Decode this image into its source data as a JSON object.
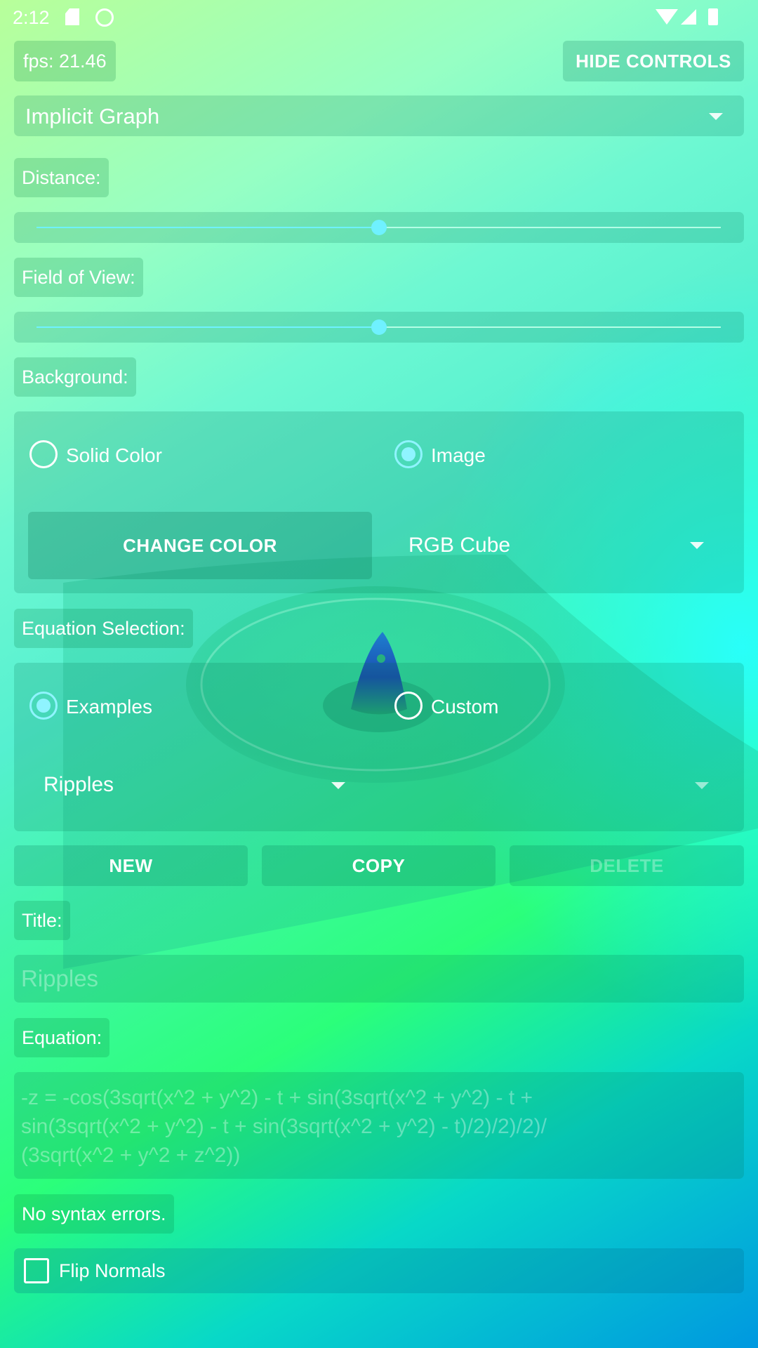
{
  "status_bar": {
    "time": "2:12",
    "icons": [
      "sd-card-icon",
      "android-icon",
      "wifi-icon",
      "signal-icon",
      "battery-icon"
    ]
  },
  "fps_label": "fps: 21.46",
  "hide_controls_label": "HIDE CONTROLS",
  "graph_type": {
    "selected": "Implicit Graph"
  },
  "distance": {
    "label": "Distance:",
    "value": 0.5
  },
  "field_of_view": {
    "label": "Field of View:",
    "value": 0.5
  },
  "background": {
    "label": "Background:",
    "options": [
      "Solid Color",
      "Image"
    ],
    "selected": "Image",
    "change_color_label": "CHANGE COLOR",
    "image_selected": "RGB Cube"
  },
  "equation_selection": {
    "label": "Equation Selection:",
    "options": [
      "Examples",
      "Custom"
    ],
    "selected": "Examples",
    "example_selected": "Ripples"
  },
  "actions": {
    "new": "NEW",
    "copy": "COPY",
    "delete": "DELETE"
  },
  "title_field": {
    "label": "Title:",
    "value": "Ripples"
  },
  "equation_field": {
    "label": "Equation:",
    "lines": [
      "-z = -cos(3sqrt(x^2 + y^2) - t + sin(3sqrt(x^2 + y^2) - t +",
      "sin(3sqrt(x^2 + y^2) - t + sin(3sqrt(x^2 + y^2) - t)/2)/2)/2)/",
      "(3sqrt(x^2 + y^2 + z^2))"
    ]
  },
  "syntax_status": "No syntax errors.",
  "flip_normals": {
    "label": "Flip Normals",
    "checked": false
  },
  "colors": {
    "accent": "#6ff1ff",
    "track_inactive": "#b4ffe6",
    "surface": "#2ae8b0"
  }
}
